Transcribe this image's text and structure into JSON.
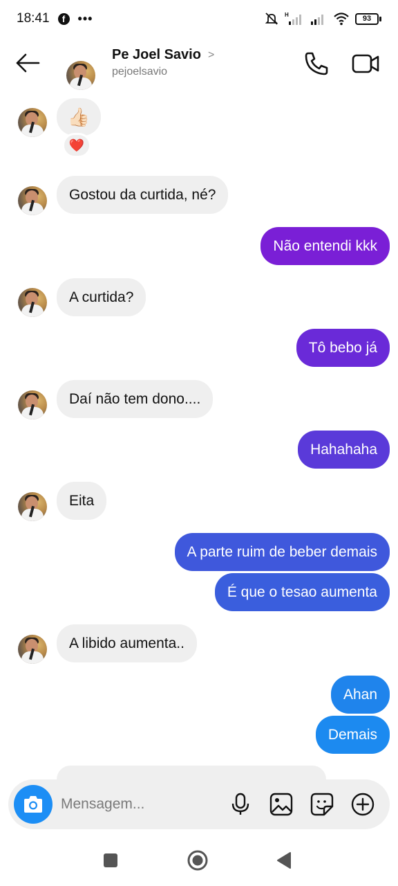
{
  "status_bar": {
    "time": "18:41",
    "fb_glyph": "f",
    "more_glyph": "•••",
    "battery_level": "93",
    "icons": [
      "facebook-icon",
      "more-dots-icon",
      "mute-icon",
      "signal-h-icon",
      "signal-icon",
      "wifi-icon",
      "battery-icon"
    ]
  },
  "header": {
    "contact_name": "Pe Joel Savio",
    "chevron": ">",
    "handle": "pejoelsavio",
    "icons": [
      "back-arrow-icon",
      "phone-icon",
      "video-camera-icon"
    ]
  },
  "messages": [
    {
      "side": "in",
      "type": "like",
      "text": "👍🏻",
      "reaction": "❤️"
    },
    {
      "side": "in",
      "text": "Gostou da curtida, né?"
    },
    {
      "side": "out",
      "text": "Não entendi kkk",
      "color": "#7a1fd6"
    },
    {
      "side": "in",
      "text": "A curtida?"
    },
    {
      "side": "out",
      "text": "Tô bebo já",
      "color": "#6a2ad8"
    },
    {
      "side": "in",
      "text": "Daí não tem dono...."
    },
    {
      "side": "out",
      "text": "Hahahaha",
      "color": "#5a3ad9"
    },
    {
      "side": "in",
      "text": "Eita"
    },
    {
      "side": "out",
      "text": "A parte ruim de beber demais",
      "color": "#3f58dc"
    },
    {
      "side": "out",
      "text": "É que o tesao aumenta",
      "color": "#3a5edd"
    },
    {
      "side": "in",
      "text": "A libido aumenta.."
    },
    {
      "side": "out",
      "text": "Ahan",
      "color": "#1f84ec"
    },
    {
      "side": "out",
      "text": "Demais",
      "color": "#1c8af0"
    }
  ],
  "composer": {
    "placeholder": "Mensagem...",
    "accent": "#1c8ef5",
    "icons": [
      "camera-icon",
      "microphone-icon",
      "image-icon",
      "sticker-icon",
      "plus-icon"
    ]
  },
  "nav": {
    "icons": [
      "recents-square-icon",
      "home-circle-icon",
      "back-triangle-icon"
    ]
  }
}
